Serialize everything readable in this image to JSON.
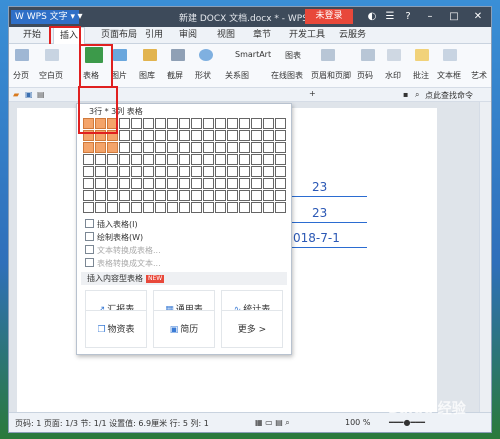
{
  "app": {
    "name": "WPS 文字",
    "doc_title": "新建 DOCX 文档.docx * - WPS 文字",
    "login_label": "未登录"
  },
  "tabs": [
    "开始",
    "插入",
    "页面布局",
    "引用",
    "审阅",
    "视图",
    "章节",
    "开发工具",
    "云服务"
  ],
  "active_tab": "插入",
  "ribbon": {
    "items": [
      "分页",
      "空白页",
      "表格",
      "图片",
      "图库",
      "截屏",
      "形状",
      "关系图",
      "在线图表",
      "页眉和页脚",
      "页码",
      "水印",
      "批注",
      "文本框",
      "艺术"
    ],
    "smartart": "SmartArt",
    "chart": "图表"
  },
  "search_placeholder": "点此查找命令",
  "dropdown": {
    "grid_label": "3行 * 3列 表格",
    "grid_rows": 8,
    "grid_cols": 17,
    "selected_rows": 3,
    "selected_cols": 3,
    "menu": [
      {
        "label": "插入表格(I)",
        "enabled": true
      },
      {
        "label": "绘制表格(W)",
        "enabled": true
      },
      {
        "label": "文本转换成表格...",
        "enabled": false
      },
      {
        "label": "表格转换成文本...",
        "enabled": false
      }
    ],
    "section_title": "插入内容型表格",
    "hot_badge": "NEW",
    "cards": [
      "汇报表",
      "通用表",
      "统计表",
      "物资表",
      "简历",
      "更多 >"
    ]
  },
  "document": {
    "lines": [
      "23",
      "23",
      "018-7-1"
    ]
  },
  "status": {
    "text": "页码: 1  页面: 1/3  节: 1/1  设置值: 6.9厘米  行: 5  列: 1",
    "zoom": "100 %"
  },
  "watermark": "Baidu 经验",
  "colors": {
    "accent": "#2f6fc7",
    "login": "#e8483a",
    "selection": "#f4a46a",
    "highlight_box": "#e02020"
  }
}
